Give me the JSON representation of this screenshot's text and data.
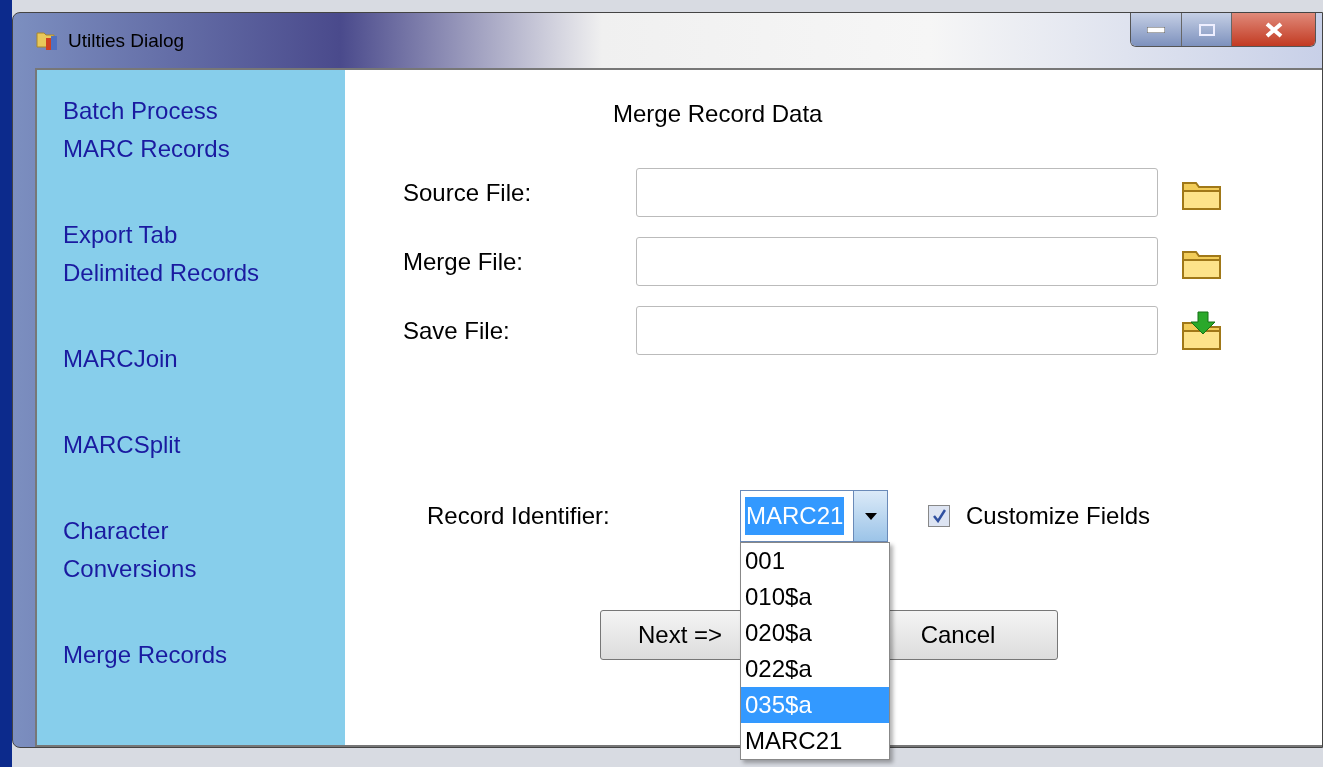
{
  "window": {
    "title": "Utilties Dialog"
  },
  "sidebar": {
    "items": [
      {
        "lines": [
          "Batch Process",
          "MARC Records"
        ]
      },
      {
        "lines": [
          "Export Tab",
          "Delimited Records"
        ]
      },
      {
        "lines": [
          "MARCJoin"
        ]
      },
      {
        "lines": [
          "MARCSplit"
        ]
      },
      {
        "lines": [
          "Character",
          "Conversions"
        ]
      },
      {
        "lines": [
          "Merge Records"
        ]
      }
    ]
  },
  "form": {
    "title": "Merge Record Data",
    "fields": [
      {
        "label": "Source File:",
        "kind": "open"
      },
      {
        "label": "Merge File:",
        "kind": "open"
      },
      {
        "label": "Save File:",
        "kind": "save"
      }
    ],
    "record_identifier": {
      "label": "Record Identifier:",
      "value": "MARC21",
      "expanded": true,
      "options": [
        {
          "label": "001",
          "highlighted": false
        },
        {
          "label": "010$a",
          "highlighted": false
        },
        {
          "label": "020$a",
          "highlighted": false
        },
        {
          "label": "022$a",
          "highlighted": false
        },
        {
          "label": "035$a",
          "highlighted": true
        },
        {
          "label": "MARC21",
          "highlighted": false
        }
      ]
    },
    "customize_fields": {
      "label": "Customize Fields",
      "checked": true
    },
    "buttons": [
      "Next =>",
      "Cancel"
    ]
  }
}
